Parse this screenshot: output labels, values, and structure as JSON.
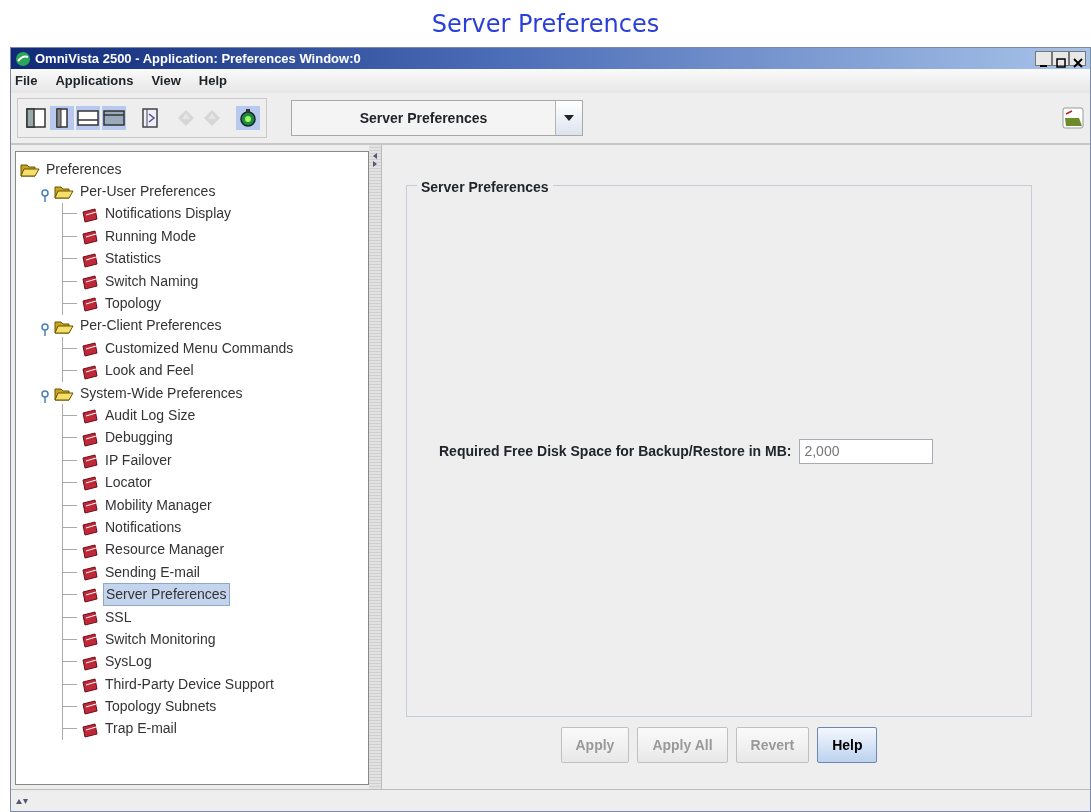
{
  "page_heading": "Server Preferences",
  "window": {
    "title": "OmniVista 2500 -  Application: Preferences  Window:0"
  },
  "menu": [
    "File",
    "Applications",
    "View",
    "Help"
  ],
  "toolbar": [
    {
      "kind": "layout-left",
      "pressed": false,
      "disabled": false
    },
    {
      "kind": "layout-narrow",
      "pressed": true,
      "disabled": false
    },
    {
      "kind": "layout-bottom",
      "pressed": true,
      "disabled": false
    },
    {
      "kind": "layout-top",
      "pressed": true,
      "disabled": false
    },
    {
      "kind": "panel-arrow",
      "pressed": false,
      "disabled": false
    },
    {
      "kind": "back",
      "pressed": false,
      "disabled": true
    },
    {
      "kind": "forward",
      "pressed": false,
      "disabled": true
    },
    {
      "kind": "status",
      "pressed": true,
      "disabled": false
    }
  ],
  "view_selector": {
    "value": "Server Preferences"
  },
  "tree": {
    "label": "Preferences",
    "selected": false,
    "children": [
      {
        "label": "Per-User Preferences",
        "selected": false,
        "expanded": true,
        "children": [
          {
            "label": "Notifications Display",
            "selected": false
          },
          {
            "label": "Running Mode",
            "selected": false
          },
          {
            "label": "Statistics",
            "selected": false
          },
          {
            "label": "Switch Naming",
            "selected": false
          },
          {
            "label": "Topology",
            "selected": false
          }
        ]
      },
      {
        "label": "Per-Client Preferences",
        "selected": false,
        "expanded": true,
        "children": [
          {
            "label": "Customized Menu Commands",
            "selected": false
          },
          {
            "label": "Look and Feel",
            "selected": false
          }
        ]
      },
      {
        "label": "System-Wide Preferences",
        "selected": false,
        "expanded": true,
        "children": [
          {
            "label": "Audit Log Size",
            "selected": false
          },
          {
            "label": "Debugging",
            "selected": false
          },
          {
            "label": "IP Failover",
            "selected": false
          },
          {
            "label": "Locator",
            "selected": false
          },
          {
            "label": "Mobility Manager",
            "selected": false
          },
          {
            "label": "Notifications",
            "selected": false
          },
          {
            "label": "Resource Manager",
            "selected": false
          },
          {
            "label": "Sending E-mail",
            "selected": false
          },
          {
            "label": "Server Preferences",
            "selected": true
          },
          {
            "label": "SSL",
            "selected": false
          },
          {
            "label": "Switch Monitoring",
            "selected": false
          },
          {
            "label": "SysLog",
            "selected": false
          },
          {
            "label": "Third-Party Device Support",
            "selected": false
          },
          {
            "label": "Topology Subnets",
            "selected": false
          },
          {
            "label": "Trap E-mail",
            "selected": false
          }
        ]
      }
    ]
  },
  "panel": {
    "title": "Server Preferences",
    "fields": [
      {
        "label": "Required Free Disk Space for Backup/Restore in MB:",
        "value": "2,000"
      }
    ]
  },
  "buttons": [
    {
      "label": "Apply",
      "disabled": true
    },
    {
      "label": "Apply All",
      "disabled": true
    },
    {
      "label": "Revert",
      "disabled": true
    },
    {
      "label": "Help",
      "disabled": false
    }
  ]
}
